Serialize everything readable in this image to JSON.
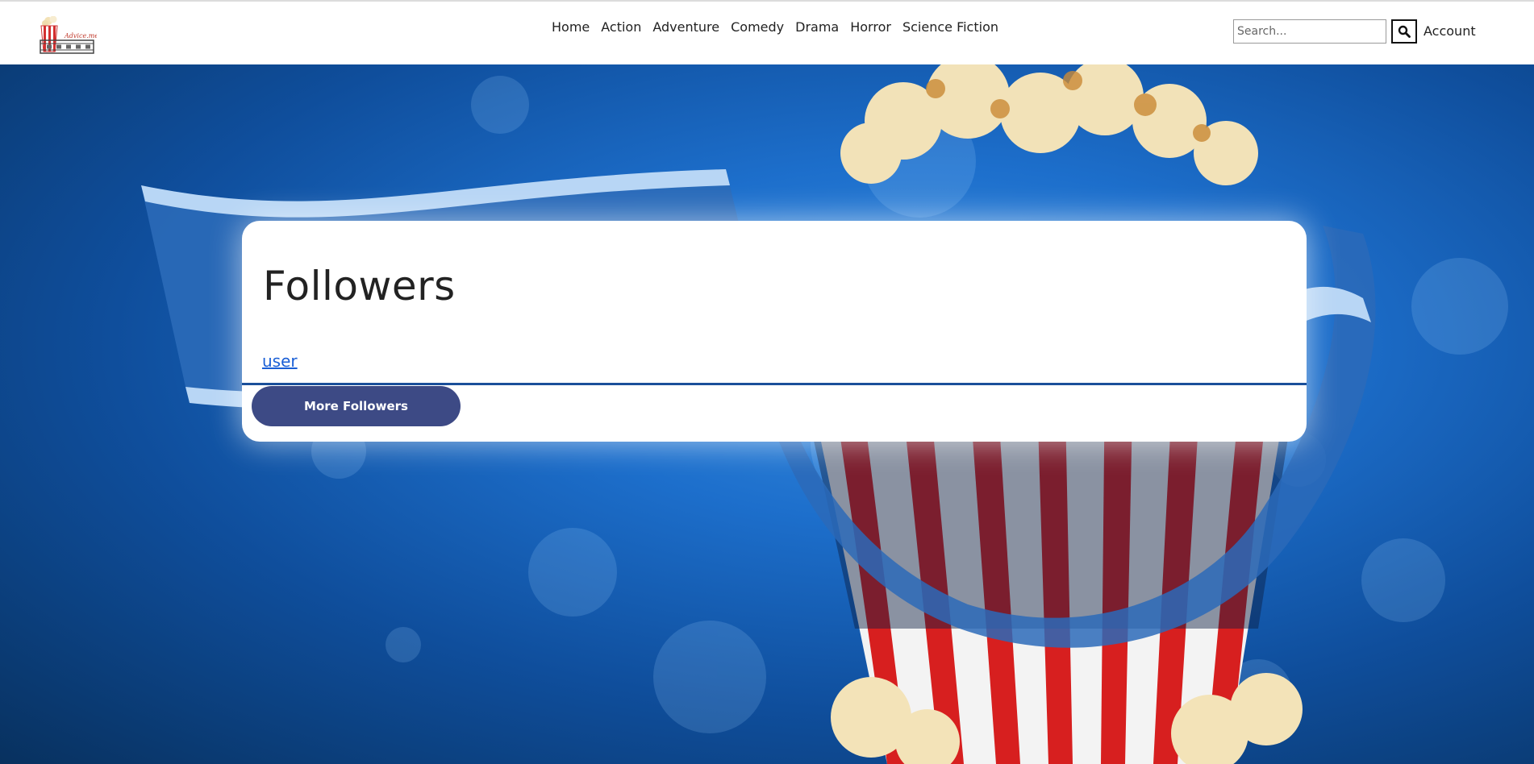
{
  "header": {
    "logo_text": "Advice.me",
    "nav": [
      "Home",
      "Action",
      "Adventure",
      "Comedy",
      "Drama",
      "Horror",
      "Science Fiction"
    ],
    "search_placeholder": "Search...",
    "account_label": "Account"
  },
  "main": {
    "title": "Followers",
    "followers": [
      "user"
    ],
    "more_button_label": "More Followers"
  },
  "colors": {
    "button_bg": "#3d4a85",
    "divider": "#1a4f9a",
    "link": "#1a5fd6",
    "hero_blue": "#1d6fcc"
  }
}
